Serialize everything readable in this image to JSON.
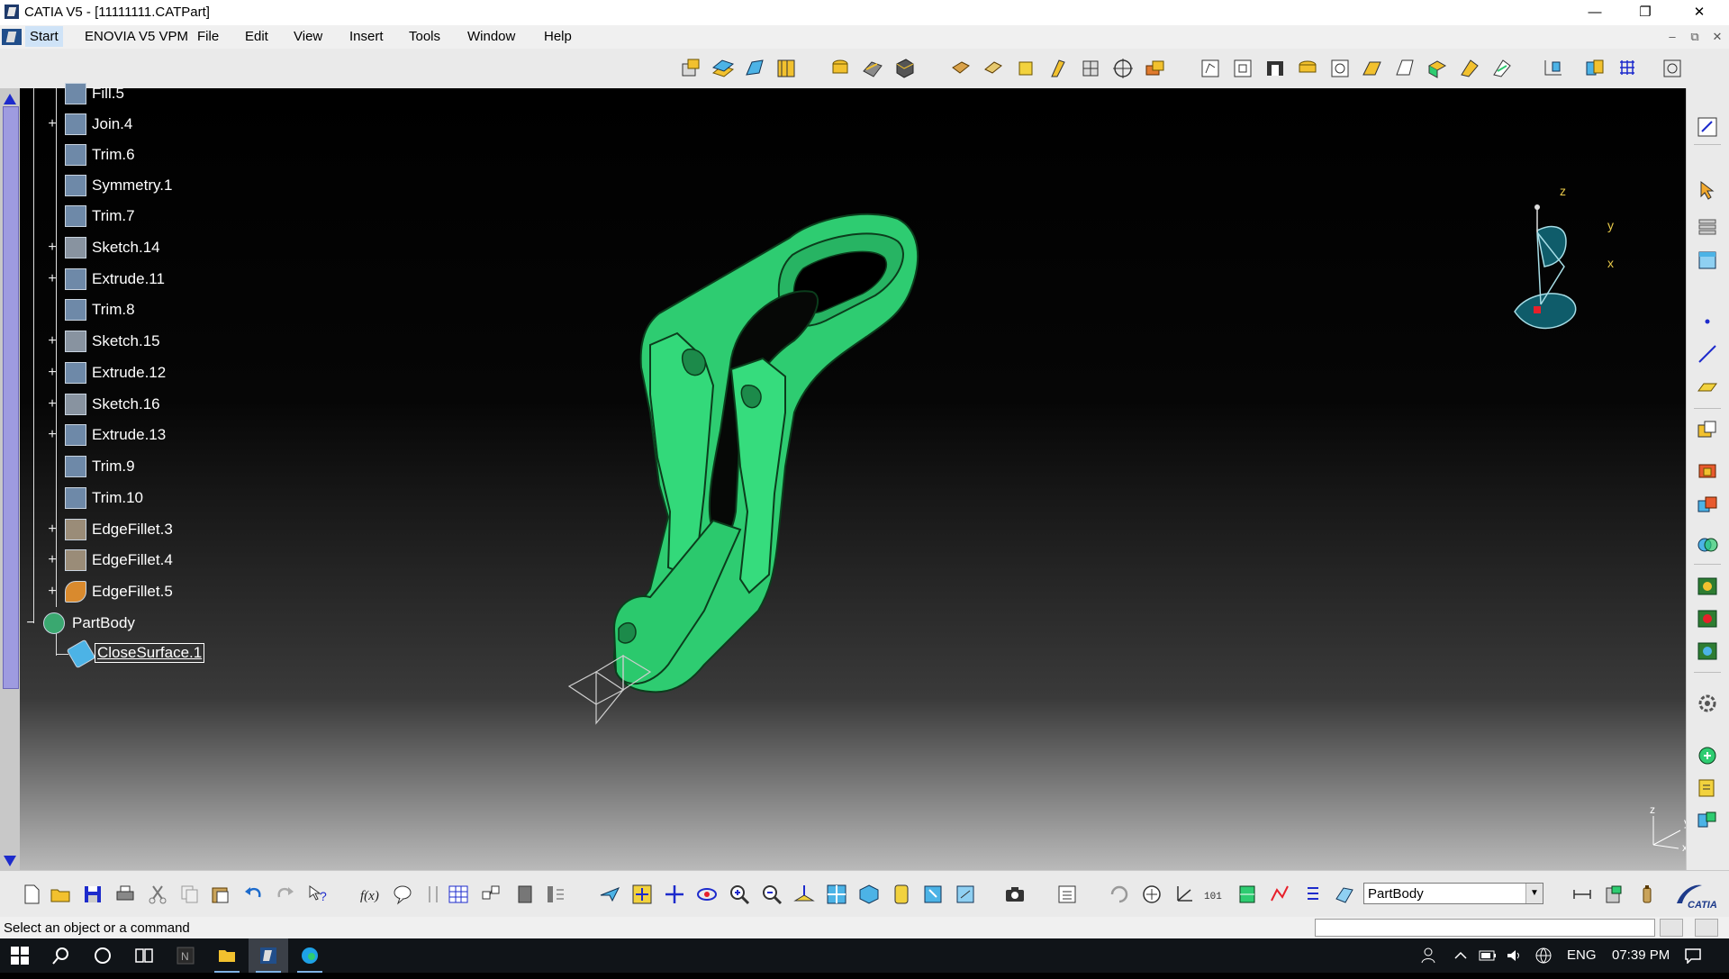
{
  "window": {
    "title": "CATIA V5 - [11111111.CATPart]",
    "minimize_glyph": "—",
    "restore_glyph": "❐",
    "close_glyph": "✕"
  },
  "menu": {
    "items": [
      "Start",
      "ENOVIA V5 VPM",
      "File",
      "Edit",
      "View",
      "Insert",
      "Tools",
      "Window",
      "Help"
    ],
    "mdi_controls": [
      "–",
      "⧉",
      "✕"
    ]
  },
  "tree": {
    "nodes": [
      {
        "label": "Fill.5",
        "icon": "fill-icon",
        "expander": ""
      },
      {
        "label": "Join.4",
        "icon": "join-icon",
        "expander": "+"
      },
      {
        "label": "Trim.6",
        "icon": "trim-icon",
        "expander": ""
      },
      {
        "label": "Symmetry.1",
        "icon": "symmetry-icon",
        "expander": ""
      },
      {
        "label": "Trim.7",
        "icon": "trim-icon",
        "expander": ""
      },
      {
        "label": "Sketch.14",
        "icon": "sketch-icon",
        "expander": "+"
      },
      {
        "label": "Extrude.11",
        "icon": "extrude-icon",
        "expander": "+"
      },
      {
        "label": "Trim.8",
        "icon": "trim-icon",
        "expander": ""
      },
      {
        "label": "Sketch.15",
        "icon": "sketch-icon",
        "expander": "+"
      },
      {
        "label": "Extrude.12",
        "icon": "extrude-icon",
        "expander": "+"
      },
      {
        "label": "Sketch.16",
        "icon": "sketch-icon",
        "expander": "+"
      },
      {
        "label": "Extrude.13",
        "icon": "extrude-icon",
        "expander": "+"
      },
      {
        "label": "Trim.9",
        "icon": "trim-icon",
        "expander": ""
      },
      {
        "label": "Trim.10",
        "icon": "trim-icon",
        "expander": ""
      },
      {
        "label": "EdgeFillet.3",
        "icon": "edge-fillet-icon",
        "expander": "+"
      },
      {
        "label": "EdgeFillet.4",
        "icon": "edge-fillet-icon",
        "expander": "+"
      },
      {
        "label": "EdgeFillet.5",
        "icon": "edge-fillet-icon",
        "expander": "+"
      }
    ],
    "partbody": {
      "label": "PartBody",
      "expander": "−"
    },
    "selected": {
      "label": "CloseSurface.1"
    }
  },
  "compass": {
    "z_label": "z",
    "y_label": "y",
    "x_label": "x"
  },
  "axis_triad": {
    "z_label": "z",
    "y_label": "y",
    "x_label": "x"
  },
  "bottom": {
    "current_body": "PartBody"
  },
  "status": {
    "message": "Select an object or a command"
  },
  "taskbar": {
    "language": "ENG",
    "time": "07:39 PM"
  },
  "colors": {
    "part_green": "#2ecc71",
    "part_edge": "#0b3d1c",
    "viewport_top": "#000000",
    "viewport_bottom": "#b9b9b9",
    "scroll_thumb": "#9e9be0"
  }
}
